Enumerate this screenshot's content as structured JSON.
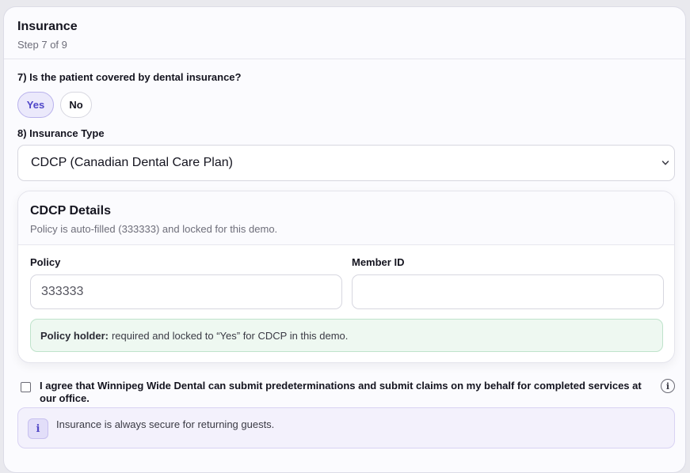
{
  "header": {
    "title": "Insurance",
    "step": "Step 7 of 9"
  },
  "question7": {
    "label": "7) Is the patient covered by dental insurance?",
    "options": [
      "Yes",
      "No"
    ],
    "selected": "Yes"
  },
  "question8": {
    "label": "8) Insurance Type",
    "selected_value": "CDCP (Canadian Dental Care Plan)",
    "chevron_icon": "chevron-down-icon"
  },
  "details": {
    "title": "CDCP Details",
    "subtitle": "Policy is auto-filled (333333) and locked for this demo.",
    "policy_label": "Policy",
    "policy_value": "333333",
    "member_label": "Member ID",
    "member_value": "",
    "note_strong": "Policy holder:",
    "note_text": "required and locked to “Yes” for CDCP in this demo."
  },
  "agreement": {
    "text": "I agree that Winnipeg Wide Dental can submit predeterminations and submit claims on my behalf for completed services at our office.",
    "checked": false,
    "info_icon": "i"
  },
  "secure_notice": {
    "icon": "i",
    "text": "Insurance is always secure for returning guests."
  },
  "colors": {
    "accent": "#4f46c8",
    "accent_bg": "#ebe9fb",
    "note_bg": "#eef8f1",
    "note_border": "#bfe3cb",
    "notice_bg": "#f3f1fc"
  }
}
